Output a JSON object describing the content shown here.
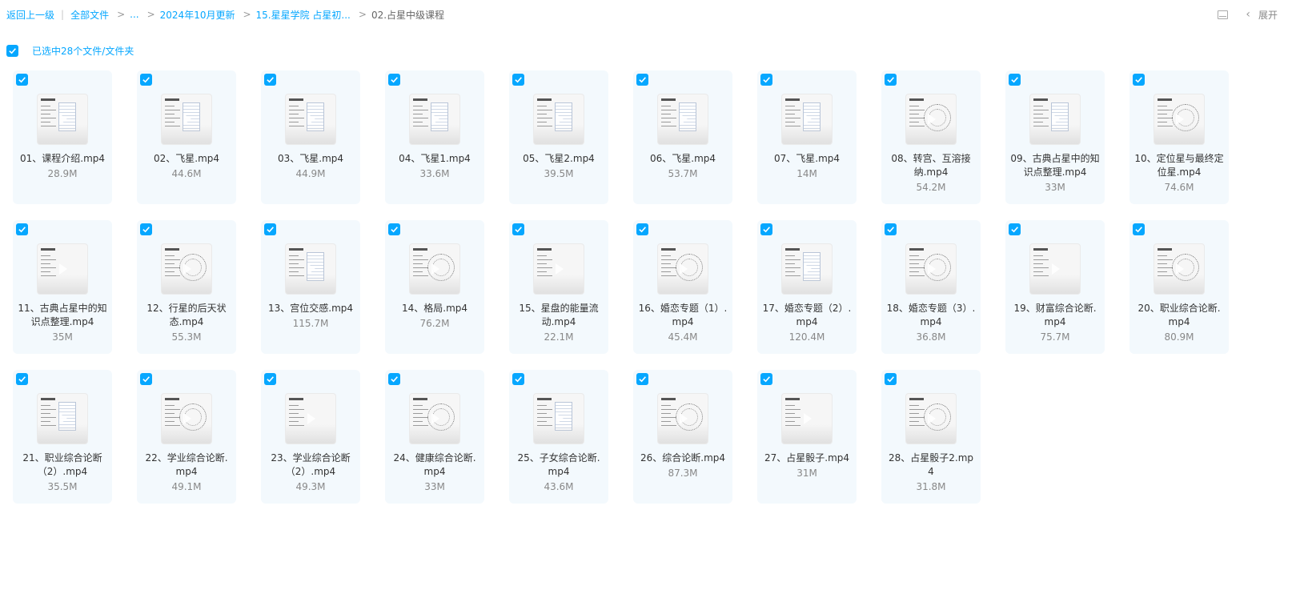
{
  "breadcrumb": {
    "back": "返回上一级",
    "root": "全部文件",
    "ellipsis": "...",
    "items": [
      "2024年10月更新",
      "15.星星学院 占星初..."
    ],
    "current": "02.占星中级课程"
  },
  "toolbar": {
    "expand_label": "展开"
  },
  "selection": {
    "summary": "已选中28个文件/文件夹"
  },
  "files": [
    {
      "name": "01、课程介绍.mp4",
      "size": "28.9M",
      "checked": true
    },
    {
      "name": "02、飞星.mp4",
      "size": "44.6M",
      "checked": true
    },
    {
      "name": "03、飞星.mp4",
      "size": "44.9M",
      "checked": true
    },
    {
      "name": "04、飞星1.mp4",
      "size": "33.6M",
      "checked": true
    },
    {
      "name": "05、飞星2.mp4",
      "size": "39.5M",
      "checked": true
    },
    {
      "name": "06、飞星.mp4",
      "size": "53.7M",
      "checked": true
    },
    {
      "name": "07、飞星.mp4",
      "size": "14M",
      "checked": true
    },
    {
      "name": "08、转宫、互溶接纳.mp4",
      "size": "54.2M",
      "checked": true
    },
    {
      "name": "09、古典占星中的知识点整理.mp4",
      "size": "33M",
      "checked": true
    },
    {
      "name": "10、定位星与最终定位星.mp4",
      "size": "74.6M",
      "checked": true
    },
    {
      "name": "11、古典占星中的知识点整理.mp4",
      "size": "35M",
      "checked": true
    },
    {
      "name": "12、行星的后天状态.mp4",
      "size": "55.3M",
      "checked": true
    },
    {
      "name": "13、宫位交感.mp4",
      "size": "115.7M",
      "checked": true
    },
    {
      "name": "14、格局.mp4",
      "size": "76.2M",
      "checked": true
    },
    {
      "name": "15、星盘的能量流动.mp4",
      "size": "22.1M",
      "checked": true
    },
    {
      "name": "16、婚恋专题（1）.mp4",
      "size": "45.4M",
      "checked": true
    },
    {
      "name": "17、婚恋专题（2）.mp4",
      "size": "120.4M",
      "checked": true
    },
    {
      "name": "18、婚恋专题（3）.mp4",
      "size": "36.8M",
      "checked": true
    },
    {
      "name": "19、财富综合论断.mp4",
      "size": "75.7M",
      "checked": true
    },
    {
      "name": "20、职业综合论断.mp4",
      "size": "80.9M",
      "checked": true
    },
    {
      "name": "21、职业综合论断（2）.mp4",
      "size": "35.5M",
      "checked": true
    },
    {
      "name": "22、学业综合论断.mp4",
      "size": "49.1M",
      "checked": true
    },
    {
      "name": "23、学业综合论断（2）.mp4",
      "size": "49.3M",
      "checked": true
    },
    {
      "name": "24、健康综合论断.mp4",
      "size": "33M",
      "checked": true
    },
    {
      "name": "25、子女综合论断.mp4",
      "size": "43.6M",
      "checked": true
    },
    {
      "name": "26、综合论断.mp4",
      "size": "87.3M",
      "checked": true
    },
    {
      "name": "27、占星骰子.mp4",
      "size": "31M",
      "checked": true
    },
    {
      "name": "28、占星骰子2.mp4",
      "size": "31.8M",
      "checked": true
    }
  ]
}
